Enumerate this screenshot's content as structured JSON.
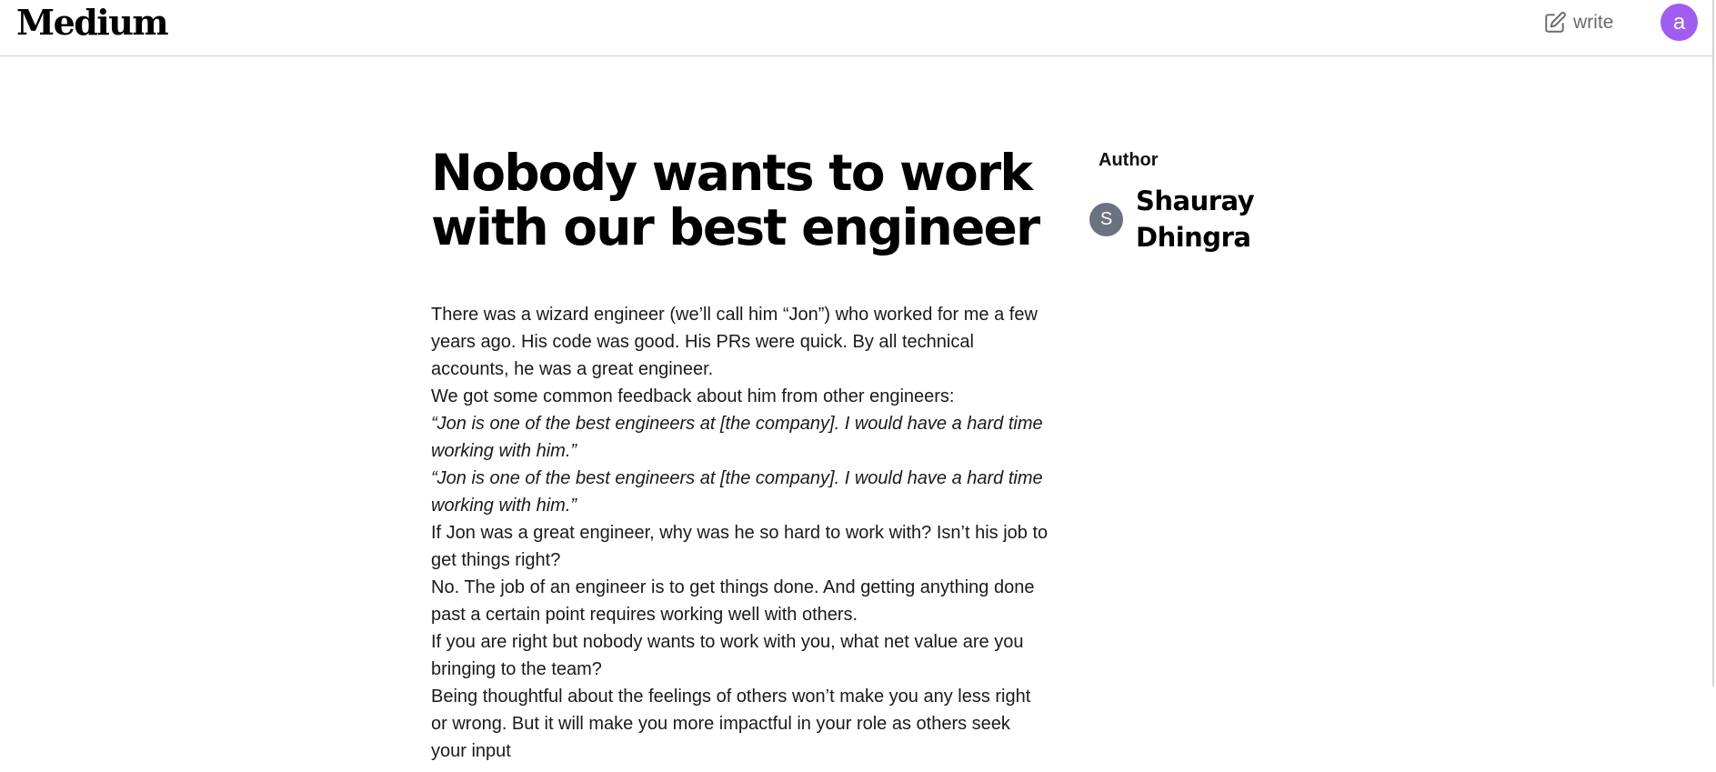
{
  "header": {
    "logo": "Medium",
    "write_label": "write",
    "user_initial": "a",
    "write_icon": "pencil-square-icon"
  },
  "article": {
    "title": "Nobody wants to work with our best engineer",
    "paragraphs": [
      {
        "text": "There was a wizard engineer (we’ll call him “Jon”) who worked for me a few years ago. His code was good. His PRs were quick. By all technical accounts, he was a great engineer.",
        "italic": false
      },
      {
        "text": "We got some common feedback about him from other engineers:",
        "italic": false
      },
      {
        "text": "“Jon is one of the best engineers at [the company]. I would have a hard time working with him.”",
        "italic": true
      },
      {
        "text": "“Jon is one of the best engineers at [the company]. I would have a hard time working with him.”",
        "italic": true
      },
      {
        "text": "If Jon was a great engineer, why was he so hard to work with? Isn’t his job to get things right?",
        "italic": false
      },
      {
        "text": "No. The job of an engineer is to get things done. And getting anything done past a certain point requires working well with others.",
        "italic": false
      },
      {
        "text": "If you are right but nobody wants to work with you, what net value are you bringing to the team?",
        "italic": false
      },
      {
        "text": "Being thoughtful about the feelings of others won’t make you any less right or wrong. But it will make you more impactful in your role as others seek your input",
        "italic": false
      }
    ]
  },
  "sidebar": {
    "heading": "Author",
    "author_initial": "S",
    "author_name": "Shauray Dhingra"
  },
  "colors": {
    "user_avatar": "#9f5ef0",
    "author_avatar": "#6b7280",
    "divider": "#d4d4d4"
  }
}
